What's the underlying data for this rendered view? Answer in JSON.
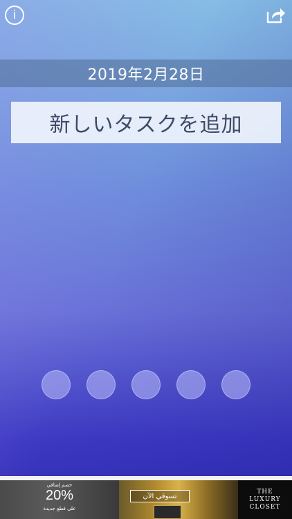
{
  "header": {
    "info_icon": "info-icon",
    "info_glyph": "i",
    "share_icon": "share-icon"
  },
  "date": {
    "text": "2019年2月28日"
  },
  "add_task": {
    "label": "新しいタスクを追加"
  },
  "dots": {
    "count": 5
  },
  "ad": {
    "top_small": "خصم إضافي",
    "percent": "20%",
    "sub_small": "على قطع جديدة",
    "shop_label": "تسوقي الآن",
    "logo": [
      "THE",
      "LUXURY",
      "CLOSET"
    ]
  },
  "colors": {
    "gradient_top": "#86bde4",
    "gradient_bottom": "#2f2bb0",
    "date_band": "#506e96",
    "button_text": "#3d4a66"
  }
}
